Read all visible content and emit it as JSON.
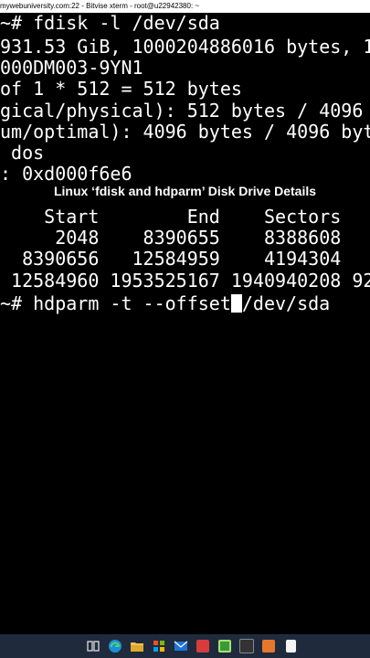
{
  "window": {
    "title": "mywebuniversity.com:22 - Bitvise xterm - root@u22942380: ~"
  },
  "terminal": {
    "lines": [
      "~# fdisk -l /dev/sda",
      "931.53 GiB, 1000204886016 bytes, 1",
      "000DM003-9YN1",
      "of 1 * 512 = 512 bytes",
      "gical/physical): 512 bytes / 4096",
      "um/optimal): 4096 bytes / 4096 byt",
      " dos",
      ": 0xd000f6e6",
      "",
      "    Start        End    Sectors",
      "     2048    8390655    8388608",
      "  8390656   12584959    4194304",
      " 12584960 1953525167 1940940208 92",
      "~# hdparm -t --offset"
    ],
    "cursor_after": "/dev/sda"
  },
  "caption": "Linux ‘fdisk and hdparm’  Disk Drive  Details",
  "taskbar": {
    "icons": [
      "task-view-icon",
      "edge-icon",
      "file-explorer-icon",
      "store-icon",
      "mail-icon",
      "app-red-icon",
      "app-green-icon",
      "app-dark-icon",
      "app-orange-icon",
      "notepad-icon"
    ]
  },
  "colors": {
    "terminal_bg": "#000000",
    "terminal_fg": "#ffffff",
    "taskbar_bg": "#1f2b3d"
  }
}
